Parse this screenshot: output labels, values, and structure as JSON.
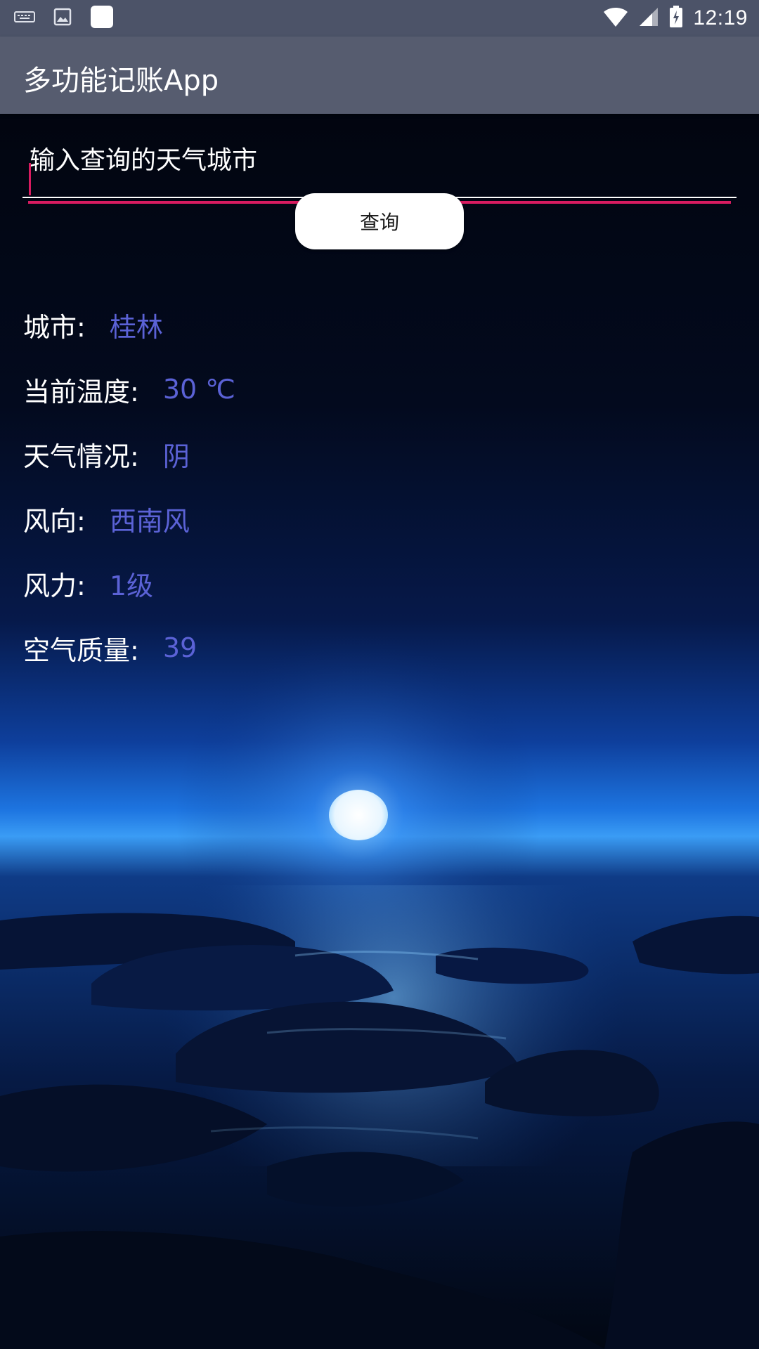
{
  "status_bar": {
    "time": "12:19",
    "icons_left": [
      "keyboard-icon",
      "image-icon",
      "app-square-icon"
    ],
    "icons_right": [
      "wifi-icon",
      "signal-icon",
      "battery-charging-icon"
    ]
  },
  "app_bar": {
    "title": "多功能记账App"
  },
  "search": {
    "placeholder": "输入查询的天气城市",
    "value": "",
    "button_label": "查询"
  },
  "weather": [
    {
      "label": "城市:",
      "value": "桂林"
    },
    {
      "label": "当前温度:",
      "value": "30 ℃"
    },
    {
      "label": "天气情况:",
      "value": "阴"
    },
    {
      "label": "风向:",
      "value": "西南风"
    },
    {
      "label": "风力:",
      "value": "1级"
    },
    {
      "label": "空气质量:",
      "value": "39"
    }
  ],
  "colors": {
    "status_bar": "#4c5368",
    "app_bar": "#565c6f",
    "accent": "#d81b60",
    "value_text": "#5b62d6",
    "label_text": "#ffffff"
  }
}
